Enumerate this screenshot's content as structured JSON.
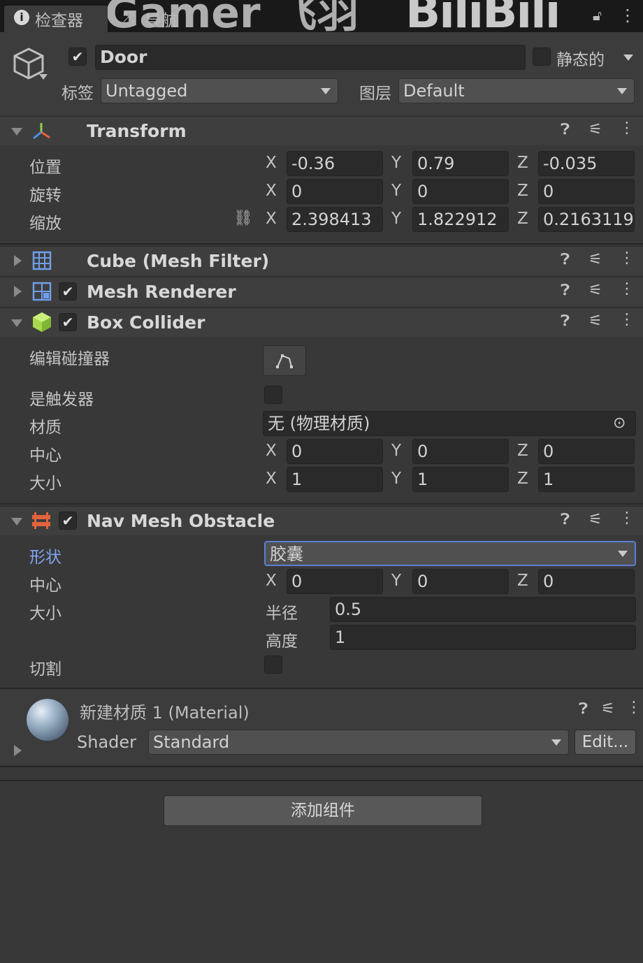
{
  "tabs": [
    {
      "label": "检查器",
      "icon": "info-icon"
    },
    {
      "label": "导航",
      "icon": "navigation-icon"
    }
  ],
  "watermark": {
    "left": "Gamer 飞羽",
    "right": "BiliBili"
  },
  "object": {
    "name": "Door",
    "active": true,
    "static_label": "静态的",
    "tag_label": "标签",
    "tag_value": "Untagged",
    "layer_label": "图层",
    "layer_value": "Default"
  },
  "transform": {
    "title": "Transform",
    "position_label": "位置",
    "rotation_label": "旋转",
    "scale_label": "缩放",
    "position": {
      "x": "-0.36",
      "y": "0.79",
      "z": "-0.035"
    },
    "rotation": {
      "x": "0",
      "y": "0",
      "z": "0"
    },
    "scale": {
      "x": "2.398413",
      "y": "1.822912",
      "z": "0.2163119"
    }
  },
  "axes": {
    "x": "X",
    "y": "Y",
    "z": "Z"
  },
  "mesh_filter": {
    "title": "Cube (Mesh Filter)"
  },
  "mesh_renderer": {
    "title": "Mesh Renderer",
    "enabled": true
  },
  "box_collider": {
    "title": "Box Collider",
    "enabled": true,
    "edit_label": "编辑碰撞器",
    "trigger_label": "是触发器",
    "material_label": "材质",
    "material_value": "无 (物理材质)",
    "center_label": "中心",
    "size_label": "大小",
    "center": {
      "x": "0",
      "y": "0",
      "z": "0"
    },
    "size": {
      "x": "1",
      "y": "1",
      "z": "1"
    }
  },
  "nav_obstacle": {
    "title": "Nav Mesh Obstacle",
    "enabled": true,
    "shape_label": "形状",
    "shape_value": "胶囊",
    "center_label": "中心",
    "size_label": "大小",
    "center": {
      "x": "0",
      "y": "0",
      "z": "0"
    },
    "radius_label": "半径",
    "radius_value": "0.5",
    "height_label": "高度",
    "height_value": "1",
    "carve_label": "切割"
  },
  "material": {
    "title": "新建材质 1 (Material)",
    "shader_label": "Shader",
    "shader_value": "Standard",
    "edit_label": "Edit..."
  },
  "add_component_label": "添加组件",
  "colors": {
    "background": "#383838",
    "header": "#3e3e3e",
    "field": "#2a2a2a",
    "accent_blue": "#5b7fd6",
    "collider_green": "#a6d94d",
    "obstacle_orange": "#e3643c"
  }
}
